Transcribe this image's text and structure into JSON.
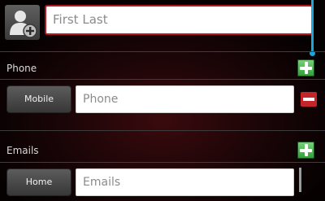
{
  "name": {
    "placeholder": "First Last"
  },
  "phone": {
    "section_label": "Phone",
    "type_label": "Mobile",
    "placeholder": "Phone",
    "add_icon": "plus-icon",
    "remove_icon": "minus-icon"
  },
  "emails": {
    "section_label": "Emails",
    "type_label": "Home",
    "placeholder": "Emails",
    "add_icon": "plus-icon"
  },
  "colors": {
    "accent_add": "#2f9d34",
    "accent_remove": "#c6242b",
    "name_border": "#b4171f",
    "scroll_indicator": "#1aa6d9"
  }
}
